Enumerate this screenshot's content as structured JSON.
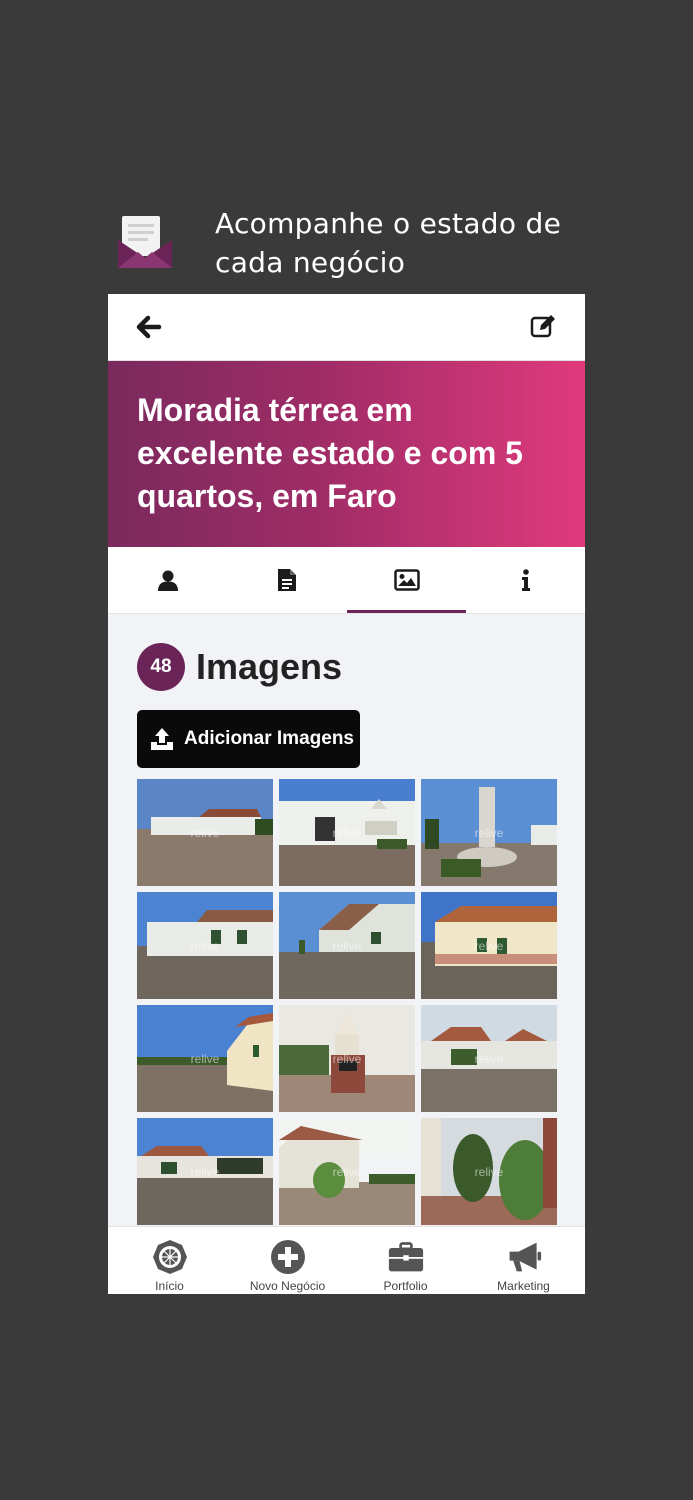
{
  "promo": {
    "title_line1": "Acompanhe o estado de",
    "title_line2": "cada negócio",
    "icon": "envelope-letter-icon"
  },
  "topbar": {
    "back_icon": "arrow-left-icon",
    "edit_icon": "edit-icon"
  },
  "hero": {
    "title": "Moradia térrea em excelente estado e com 5 quartos, em Faro",
    "colors": [
      "#7a2a5e",
      "#e03a7c"
    ]
  },
  "tabs": [
    {
      "icon": "user-icon",
      "active": false
    },
    {
      "icon": "document-icon",
      "active": false
    },
    {
      "icon": "image-icon",
      "active": true
    },
    {
      "icon": "info-icon",
      "active": false
    }
  ],
  "gallery": {
    "count": "48",
    "title": "Imagens",
    "add_label": "Adicionar Imagens",
    "watermark": "relive",
    "images": [
      "photo-1",
      "photo-2",
      "photo-3",
      "photo-4",
      "photo-5",
      "photo-6",
      "photo-7",
      "photo-8",
      "photo-9",
      "photo-10",
      "photo-11",
      "photo-12"
    ]
  },
  "nav": [
    {
      "label": "Início",
      "icon": "home-star-icon"
    },
    {
      "label": "Novo Negócio",
      "icon": "plus-circle-icon"
    },
    {
      "label": "Portfolio",
      "icon": "briefcase-icon"
    },
    {
      "label": "Marketing",
      "icon": "megaphone-icon"
    }
  ],
  "accent": "#6b2457"
}
